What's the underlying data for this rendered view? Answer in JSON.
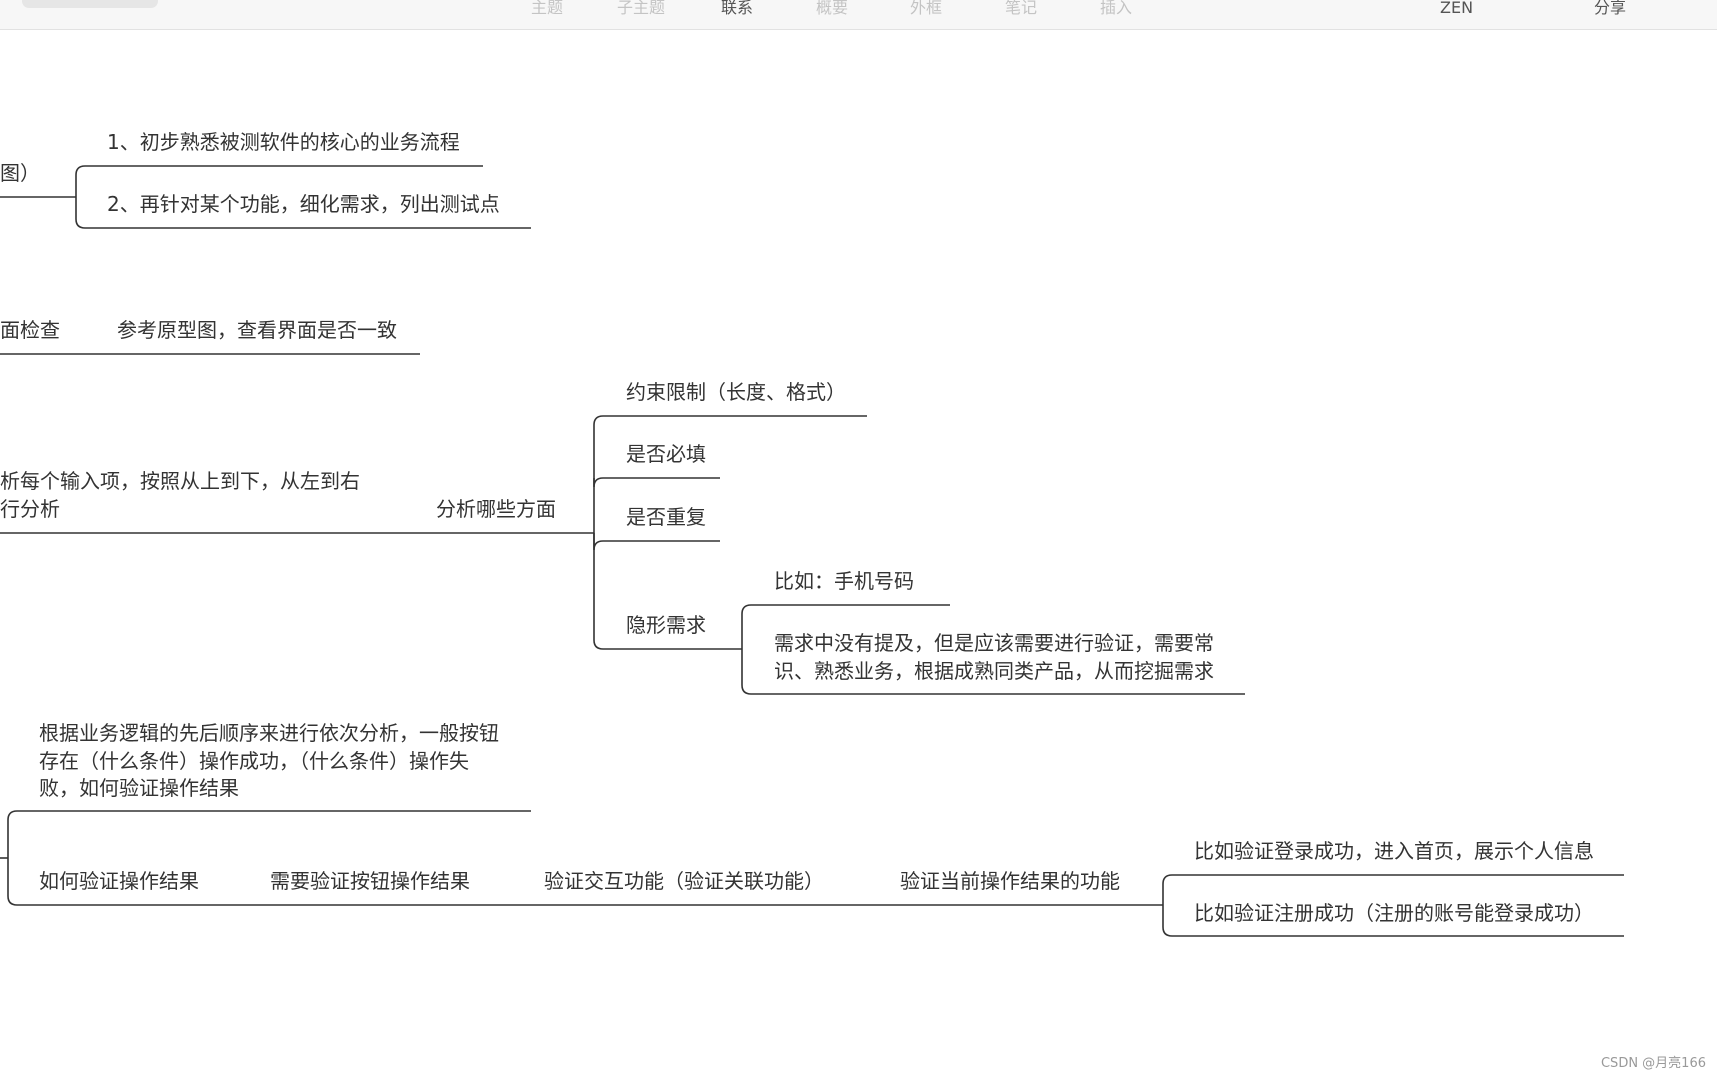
{
  "toolbar": {
    "items": [
      "主题",
      "子主题",
      "联系",
      "概要",
      "外框",
      "笔记",
      "插入"
    ],
    "active": "联系",
    "zen": "ZEN",
    "share": "分享"
  },
  "mindmap": {
    "top_branch_label": "图）",
    "step1": "1、初步熟悉被测软件的核心的业务流程",
    "step2": "2、再针对某个功能，细化需求，列出测试点",
    "ui_check": "面检查",
    "ui_check_detail": "参考原型图，查看界面是否一致",
    "input_analysis_line1": "析每个输入项，按照从上到下，从左到右",
    "input_analysis_line2": "行分析",
    "aspects": "分析哪些方面",
    "aspect_constraints": "约束限制（长度、格式）",
    "aspect_required": "是否必填",
    "aspect_duplicate": "是否重复",
    "aspect_hidden": "隐形需求",
    "hidden_example": "比如：手机号码",
    "hidden_desc_line1": "需求中没有提及，但是应该需要进行验证，需要常",
    "hidden_desc_line2": "识、熟悉业务，根据成熟同类产品，从而挖掘需求",
    "logic_line1": "根据业务逻辑的先后顺序来进行依次分析，一般按钮",
    "logic_line2": "存在（什么条件）操作成功，（什么条件）操作失",
    "logic_line3": "败，如何验证操作结果",
    "verify_result": "如何验证操作结果",
    "verify_button": "需要验证按钮操作结果",
    "verify_interaction": "验证交互功能（验证关联功能）",
    "verify_current": "验证当前操作结果的功能",
    "example_login": "比如验证登录成功，进入首页，展示个人信息",
    "example_register": "比如验证注册成功（注册的账号能登录成功）"
  },
  "watermark": "CSDN @月亮166"
}
